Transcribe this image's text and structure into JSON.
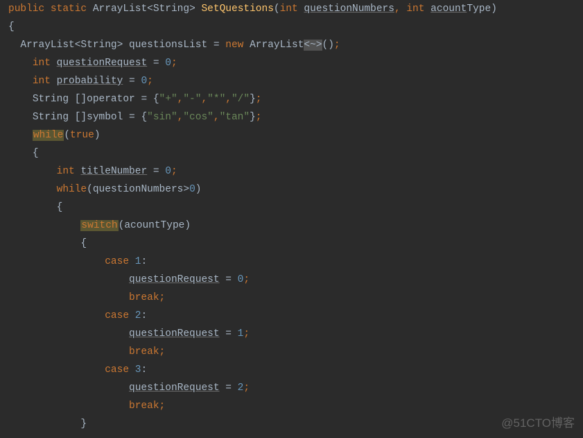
{
  "code": {
    "line1_public": "public",
    "line1_static": "static",
    "line1_rettype": "ArrayList<String>",
    "line1_method": "SetQuestions",
    "line1_int1": "int",
    "line1_param1": "questionNumbers",
    "line1_int2": "int",
    "line1_param2_u": "acount",
    "line1_param2_tail": "Type)",
    "line2_brace": "{",
    "line3_decl": "ArrayList<String> questionsList = ",
    "line3_new": "new",
    "line3_arraylist": " ArrayList",
    "line3_generic": "<~>",
    "line3_end": "()",
    "line4_int": "int",
    "line4_var": "questionRequest",
    "line4_eq": " = ",
    "line4_num": "0",
    "line5_int": "int",
    "line5_var": "probability",
    "line5_eq": " = ",
    "line5_num": "0",
    "line6_decl": "String []operator = {",
    "line6_s1": "\"+\"",
    "line6_s2": "\"-\"",
    "line6_s3": "\"*\"",
    "line6_s4": "\"/\"",
    "line6_end": "}",
    "line7_decl": "String []symbol = {",
    "line7_s1": "\"sin\"",
    "line7_s2": "\"cos\"",
    "line7_s3": "\"tan\"",
    "line7_end": "}",
    "line8_while": "while",
    "line8_true": "true",
    "line9_brace": "{",
    "line10_int": "int",
    "line10_var": "titleNumber",
    "line10_eq": " = ",
    "line10_num": "0",
    "line11_while": "while",
    "line11_cond1": "(questionNumbers>",
    "line11_num": "0",
    "line11_cond2": ")",
    "line12_brace": "{",
    "line13_switch": "switch",
    "line13_expr": "(acountType)",
    "line14_brace": "{",
    "line15_case": "case",
    "line15_num": "1",
    "line16_var": "questionRequest",
    "line16_eq": " = ",
    "line16_num": "0",
    "line17_break": "break",
    "line18_case": "case",
    "line18_num": "2",
    "line19_var": "questionRequest",
    "line19_eq": " = ",
    "line19_num": "1",
    "line20_break": "break",
    "line21_case": "case",
    "line21_num": "3",
    "line22_var": "questionRequest",
    "line22_eq": " = ",
    "line22_num": "2",
    "line23_break": "break",
    "line24_brace": "}"
  },
  "watermark": "@51CTO博客"
}
